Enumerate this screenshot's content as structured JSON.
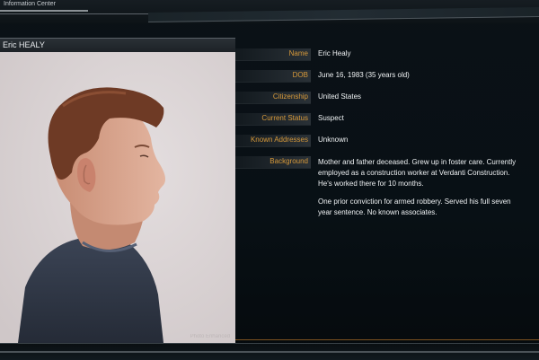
{
  "app": {
    "title": "Information Center"
  },
  "profile": {
    "header_name": "Eric HEALY",
    "photo_watermark": "Photo Enhanced"
  },
  "fields": [
    {
      "label": "Name",
      "value": "Eric Healy"
    },
    {
      "label": "DOB",
      "value": "June 16, 1983 (35 years old)"
    },
    {
      "label": "Citizenship",
      "value": "United States"
    },
    {
      "label": "Current Status",
      "value": "Suspect"
    },
    {
      "label": "Known Addresses",
      "value": "Unknown"
    },
    {
      "label": "Background",
      "paragraphs": [
        "Mother and father deceased.  Grew up in foster care. Currently employed as a construction worker at Verdanti Construction. He's worked there for 10 months.",
        "One prior conviction for armed robbery. Served his full seven year sentence. No known associates."
      ]
    }
  ],
  "colors": {
    "label_text": "#d89a3a",
    "value_text": "#eef1f3",
    "background": "#0b1116",
    "photo_background": "#d9d3d4"
  }
}
